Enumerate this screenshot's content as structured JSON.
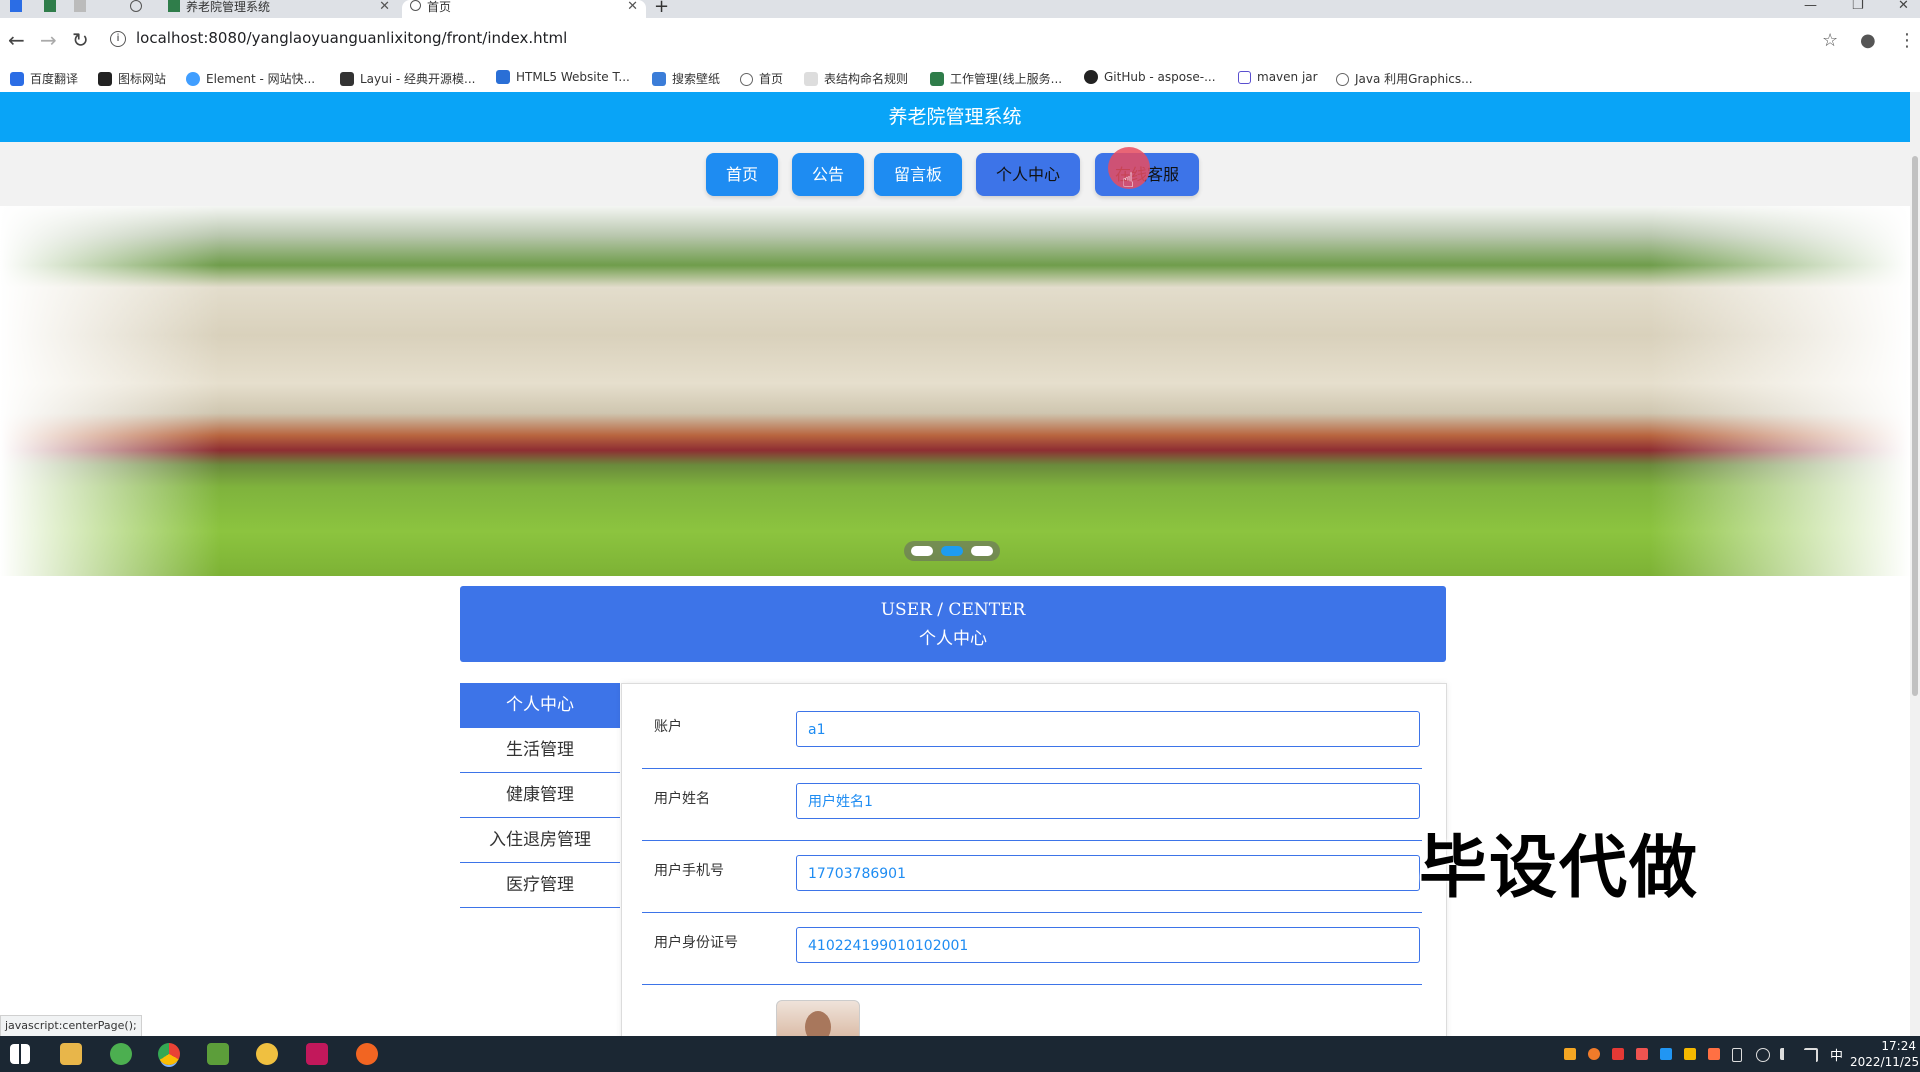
{
  "browser": {
    "tabs": [
      {
        "title": "养老院管理系统",
        "active": false
      },
      {
        "title": "首页",
        "active": true
      }
    ],
    "url": "localhost:8080/yanglaoyuanguanlixitong/front/index.html",
    "bookmarks": [
      {
        "label": "百度翻译",
        "icon": "baidu-translate-icon",
        "color": "#2b6de5"
      },
      {
        "label": "图标网站",
        "icon": "icon-site-icon",
        "color": "#222222"
      },
      {
        "label": "Element - 网站快...",
        "icon": "element-icon",
        "color": "#409eff"
      },
      {
        "label": "Layui - 经典开源模...",
        "icon": "layui-icon",
        "color": "#333333"
      },
      {
        "label": "HTML5 Website T...",
        "icon": "html5-icon",
        "color": "#2a6fd6"
      },
      {
        "label": "搜索壁纸",
        "icon": "wallpaper-icon",
        "color": "#3b7dd8"
      },
      {
        "label": "首页",
        "icon": "globe-icon",
        "color": "#666666"
      },
      {
        "label": "表结构命名规则",
        "icon": "doc-icon",
        "color": "#cccccc"
      },
      {
        "label": "工作管理(线上服务...",
        "icon": "vue-icon",
        "color": "#2f7d4a"
      },
      {
        "label": "GitHub - aspose-...",
        "icon": "github-icon",
        "color": "#222222"
      },
      {
        "label": "maven jar",
        "icon": "hexagon-icon",
        "color": "#5a4fcf"
      },
      {
        "label": "Java 利用Graphics...",
        "icon": "globe-icon",
        "color": "#666666"
      }
    ],
    "status_text": "javascript:centerPage();"
  },
  "header": {
    "title": "养老院管理系统"
  },
  "nav": {
    "items": [
      "首页",
      "公告",
      "留言板",
      "个人中心",
      "在线客服"
    ]
  },
  "banner": {
    "slide_count": 3,
    "active_slide": 2
  },
  "center_title": {
    "en": "USER / CENTER",
    "cn": "个人中心"
  },
  "side_menu": {
    "items": [
      "个人中心",
      "生活管理",
      "健康管理",
      "入住退房管理",
      "医疗管理"
    ],
    "active_index": 0
  },
  "form": {
    "fields": [
      {
        "label": "账户",
        "value": "a1"
      },
      {
        "label": "用户姓名",
        "value": "用户姓名1"
      },
      {
        "label": "用户手机号",
        "value": "17703786901"
      },
      {
        "label": "用户身份证号",
        "value": "410224199010102001"
      }
    ]
  },
  "overlay": {
    "watermark": "毕设代做"
  },
  "taskbar": {
    "time": "17:24",
    "date": "2022/11/25",
    "ime": "中"
  },
  "colors": {
    "header_bg": "#09a4f7",
    "nav_btn": "#1e8cf2",
    "primary": "#3d74e8"
  }
}
